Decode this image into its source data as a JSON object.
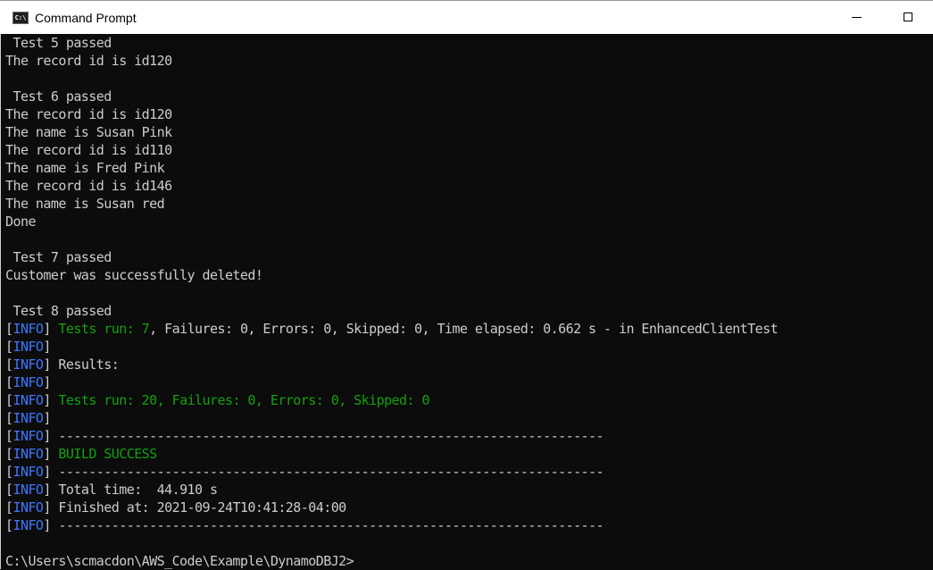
{
  "window": {
    "title": "Command Prompt",
    "icon": "cmd-icon",
    "controls": [
      "minimize",
      "maximize"
    ]
  },
  "colors": {
    "background": "#0c0c0c",
    "text": "#cccccc",
    "info_tag": "#3b78ff",
    "success": "#13a10e"
  },
  "console": {
    "lines": [
      {
        "segments": [
          {
            "text": " Test 5 passed",
            "style": "gray"
          }
        ]
      },
      {
        "segments": [
          {
            "text": "The record id is id120",
            "style": "gray"
          }
        ]
      },
      {
        "segments": [
          {
            "text": "",
            "style": "gray"
          }
        ]
      },
      {
        "segments": [
          {
            "text": " Test 6 passed",
            "style": "gray"
          }
        ]
      },
      {
        "segments": [
          {
            "text": "The record id is id120",
            "style": "gray"
          }
        ]
      },
      {
        "segments": [
          {
            "text": "The name is Susan Pink",
            "style": "gray"
          }
        ]
      },
      {
        "segments": [
          {
            "text": "The record id is id110",
            "style": "gray"
          }
        ]
      },
      {
        "segments": [
          {
            "text": "The name is Fred Pink",
            "style": "gray"
          }
        ]
      },
      {
        "segments": [
          {
            "text": "The record id is id146",
            "style": "gray"
          }
        ]
      },
      {
        "segments": [
          {
            "text": "The name is Susan red",
            "style": "gray"
          }
        ]
      },
      {
        "segments": [
          {
            "text": "Done",
            "style": "gray"
          }
        ]
      },
      {
        "segments": [
          {
            "text": "",
            "style": "gray"
          }
        ]
      },
      {
        "segments": [
          {
            "text": " Test 7 passed",
            "style": "gray"
          }
        ]
      },
      {
        "segments": [
          {
            "text": "Customer was successfully deleted!",
            "style": "gray"
          }
        ]
      },
      {
        "segments": [
          {
            "text": "",
            "style": "gray"
          }
        ]
      },
      {
        "segments": [
          {
            "text": " Test 8 passed",
            "style": "gray"
          }
        ]
      },
      {
        "segments": [
          {
            "text": "[",
            "style": "gray"
          },
          {
            "text": "INFO",
            "style": "info"
          },
          {
            "text": "] ",
            "style": "gray"
          },
          {
            "text": "Tests run: 7",
            "style": "ok"
          },
          {
            "text": ", Failures: 0, Errors: 0, Skipped: 0, Time elapsed: 0.662 s - in EnhancedClientTest",
            "style": "gray"
          }
        ]
      },
      {
        "segments": [
          {
            "text": "[",
            "style": "gray"
          },
          {
            "text": "INFO",
            "style": "info"
          },
          {
            "text": "]",
            "style": "gray"
          }
        ]
      },
      {
        "segments": [
          {
            "text": "[",
            "style": "gray"
          },
          {
            "text": "INFO",
            "style": "info"
          },
          {
            "text": "] Results:",
            "style": "gray"
          }
        ]
      },
      {
        "segments": [
          {
            "text": "[",
            "style": "gray"
          },
          {
            "text": "INFO",
            "style": "info"
          },
          {
            "text": "]",
            "style": "gray"
          }
        ]
      },
      {
        "segments": [
          {
            "text": "[",
            "style": "gray"
          },
          {
            "text": "INFO",
            "style": "info"
          },
          {
            "text": "] ",
            "style": "gray"
          },
          {
            "text": "Tests run: 20, Failures: 0, Errors: 0, Skipped: 0",
            "style": "ok"
          }
        ]
      },
      {
        "segments": [
          {
            "text": "[",
            "style": "gray"
          },
          {
            "text": "INFO",
            "style": "info"
          },
          {
            "text": "]",
            "style": "gray"
          }
        ]
      },
      {
        "segments": [
          {
            "text": "[",
            "style": "gray"
          },
          {
            "text": "INFO",
            "style": "info"
          },
          {
            "text": "] ------------------------------------------------------------------------",
            "style": "gray"
          }
        ]
      },
      {
        "segments": [
          {
            "text": "[",
            "style": "gray"
          },
          {
            "text": "INFO",
            "style": "info"
          },
          {
            "text": "] ",
            "style": "gray"
          },
          {
            "text": "BUILD SUCCESS",
            "style": "ok"
          }
        ]
      },
      {
        "segments": [
          {
            "text": "[",
            "style": "gray"
          },
          {
            "text": "INFO",
            "style": "info"
          },
          {
            "text": "] ------------------------------------------------------------------------",
            "style": "gray"
          }
        ]
      },
      {
        "segments": [
          {
            "text": "[",
            "style": "gray"
          },
          {
            "text": "INFO",
            "style": "info"
          },
          {
            "text": "] Total time:  44.910 s",
            "style": "gray"
          }
        ]
      },
      {
        "segments": [
          {
            "text": "[",
            "style": "gray"
          },
          {
            "text": "INFO",
            "style": "info"
          },
          {
            "text": "] Finished at: 2021-09-24T10:41:28-04:00",
            "style": "gray"
          }
        ]
      },
      {
        "segments": [
          {
            "text": "[",
            "style": "gray"
          },
          {
            "text": "INFO",
            "style": "info"
          },
          {
            "text": "] ------------------------------------------------------------------------",
            "style": "gray"
          }
        ]
      },
      {
        "segments": [
          {
            "text": "",
            "style": "gray"
          }
        ]
      },
      {
        "segments": [
          {
            "text": "C:\\Users\\scmacdon\\AWS_Code\\Example\\DynamoDBJ2>",
            "style": "gray"
          }
        ]
      }
    ]
  }
}
